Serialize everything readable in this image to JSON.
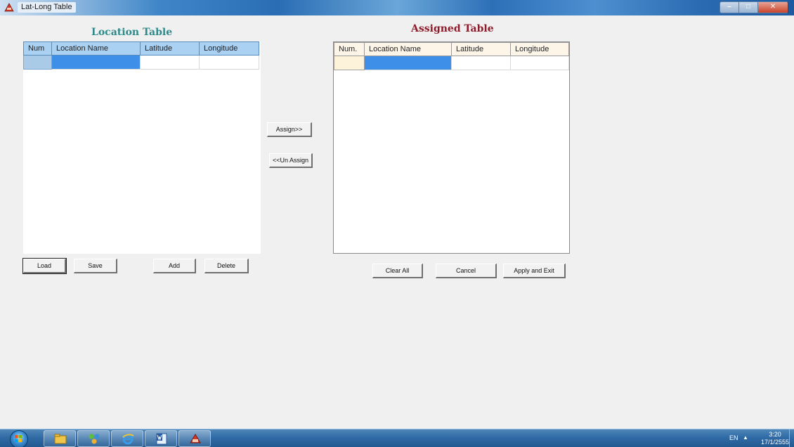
{
  "window": {
    "title": "Lat-Long Table"
  },
  "location_table": {
    "title": "Location Table",
    "columns": [
      "Num",
      "Location Name",
      "Latitude",
      "Longitude"
    ]
  },
  "assigned_table": {
    "title": "Assigned Table",
    "columns": [
      "Num.",
      "Location Name",
      "Latitude",
      "Longitude"
    ]
  },
  "buttons": {
    "assign": "Assign>>",
    "unassign": "<<Un Assign",
    "load": "Load",
    "save": "Save",
    "add": "Add",
    "delete": "Delete",
    "clear_all": "Clear All",
    "cancel": "Cancel",
    "apply_exit": "Apply and Exit"
  },
  "taskbar": {
    "items": [
      "start-orb",
      "file-explorer-icon",
      "network-icon",
      "internet-explorer-icon",
      "word-icon",
      "app-icon"
    ],
    "language": "EN",
    "time": "3:20",
    "date": "17/1/2555"
  },
  "colors": {
    "location_title": "#2e8a8a",
    "assigned_title": "#8e1a2a",
    "selected_cell": "#3d8fe8",
    "location_header": "#aad0f2",
    "assigned_header": "#fdf5e8"
  }
}
